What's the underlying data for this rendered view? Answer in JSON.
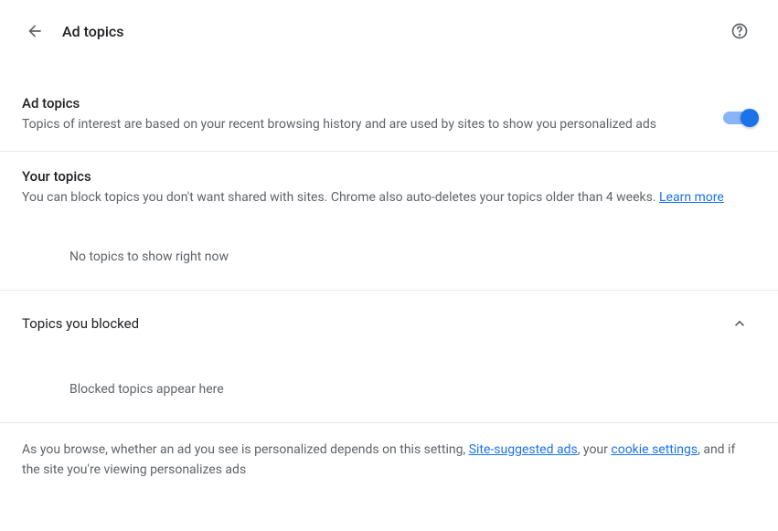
{
  "header": {
    "title": "Ad topics"
  },
  "adTopics": {
    "title": "Ad topics",
    "desc": "Topics of interest are based on your recent browsing history and are used by sites to show you personalized ads",
    "toggleOn": true
  },
  "yourTopics": {
    "title": "Your topics",
    "descPart1": "You can block topics you don't want shared with sites. Chrome also auto-deletes your topics older than 4 weeks. ",
    "learnMore": "Learn more",
    "empty": "No topics to show right now"
  },
  "blocked": {
    "title": "Topics you blocked",
    "empty": "Blocked topics appear here"
  },
  "footer": {
    "part1": "As you browse, whether an ad you see is personalized depends on this setting, ",
    "link1": "Site-suggested ads",
    "part2": ", your ",
    "link2": "cookie settings",
    "part3": ", and if the site you're viewing personalizes ads"
  }
}
